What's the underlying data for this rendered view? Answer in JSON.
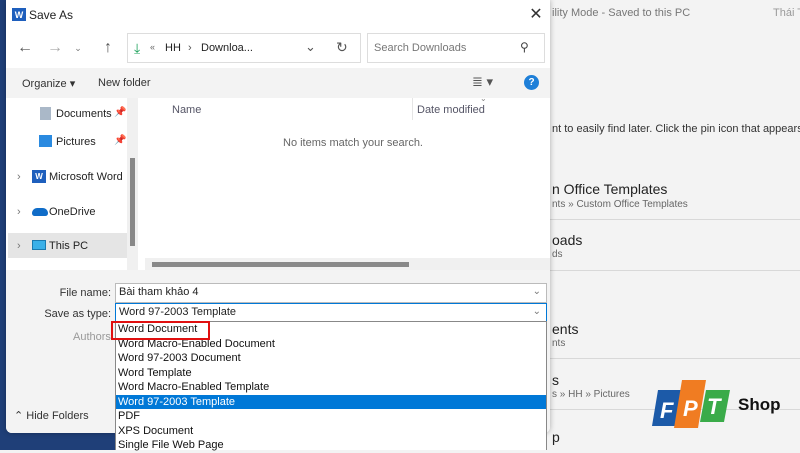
{
  "background": {
    "title_fragment": "ility Mode  -  Saved to this PC",
    "user_fragment": "Thái T",
    "hint": "nt to easily find later. Click the pin icon that appears wh",
    "items": [
      {
        "title": "n Office Templates",
        "path": "nts » Custom Office Templates"
      },
      {
        "title": "oads",
        "path": "ds"
      },
      {
        "title": "ents",
        "path": "nts"
      },
      {
        "title": "s",
        "path": "s » HH » Pictures"
      },
      {
        "title": "p",
        "path": ""
      }
    ],
    "watermark": "FPT Shop",
    "watermark_shop": "Shop"
  },
  "dialog": {
    "title": "Save As",
    "address": {
      "prefix": "«",
      "parts": [
        "HH",
        "Downloa..."
      ],
      "sep": "›"
    },
    "search_placeholder": "Search Downloads",
    "toolbar": {
      "organize": "Organize ▾",
      "new_folder": "New folder"
    },
    "nav": [
      {
        "label": "Documents",
        "pinned": true
      },
      {
        "label": "Pictures",
        "pinned": true
      },
      {
        "label": "Microsoft Word"
      },
      {
        "label": "OneDrive"
      },
      {
        "label": "This PC",
        "selected": true
      }
    ],
    "columns": [
      "Name",
      "Date modified"
    ],
    "empty_message": "No items match your search.",
    "file_name_label": "File name:",
    "file_name": "Bài tham khảo 4",
    "save_type_label": "Save as type:",
    "save_type": "Word 97-2003 Template",
    "authors_label": "Authors",
    "hide_folders": "Hide Folders",
    "type_options": [
      "Word Document",
      "Word Macro-Enabled Document",
      "Word 97-2003 Document",
      "Word Template",
      "Word Macro-Enabled Template",
      "Word 97-2003 Template",
      "PDF",
      "XPS Document",
      "Single File Web Page"
    ],
    "selected_option_index": 5,
    "highlight_color": "#e01010",
    "accent": "#0078d7"
  }
}
